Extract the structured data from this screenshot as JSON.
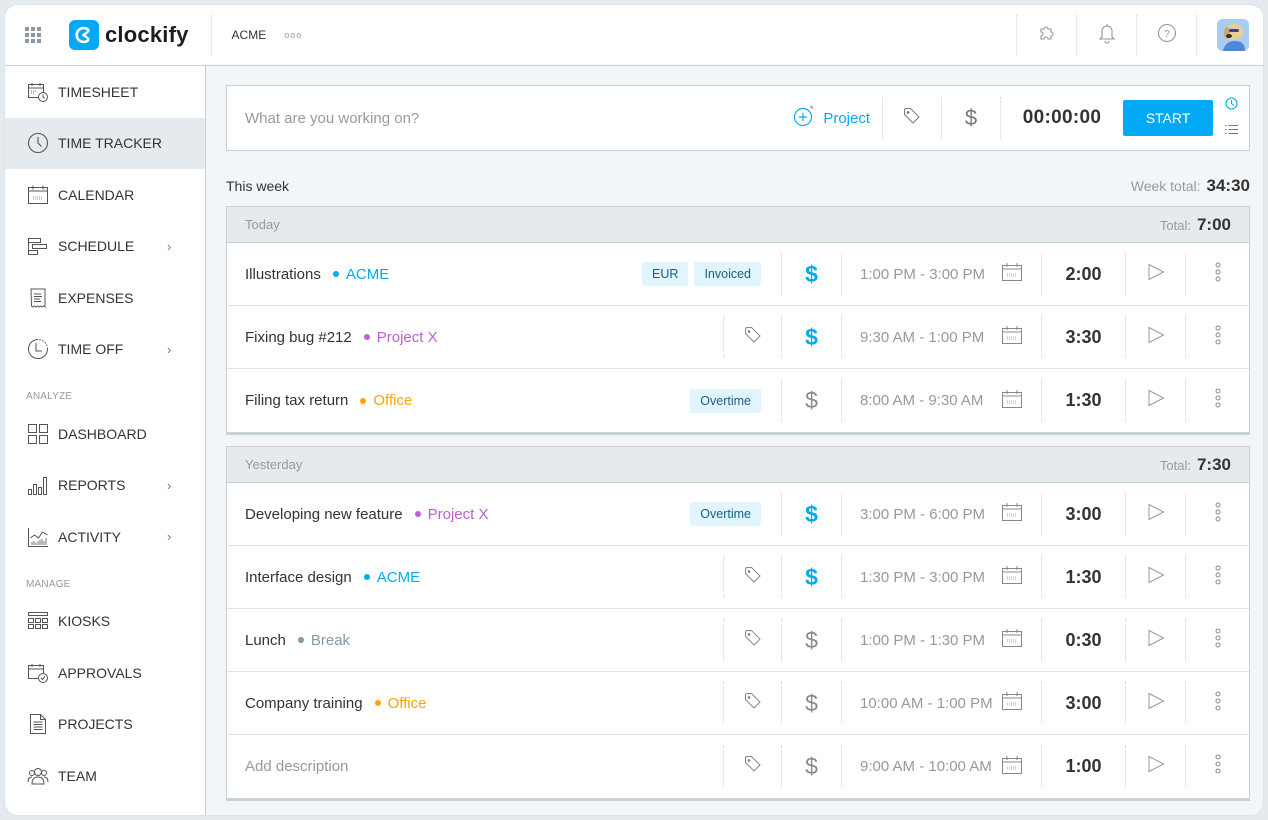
{
  "app": {
    "logo_text": "clockify",
    "workspace": "ACME",
    "workspace_more": "ooo"
  },
  "colors": {
    "accent": "#03a9f4",
    "acme": "#03a9f4",
    "project_x": "#bf5ed6",
    "office": "#ffa500",
    "break": "#8099ac"
  },
  "header": {
    "icons": [
      "puzzle-icon",
      "bell-icon",
      "help-icon"
    ]
  },
  "sidebar": {
    "items": [
      {
        "label": "TIMESHEET",
        "icon": "timesheet-icon",
        "active": false,
        "chevron": false
      },
      {
        "label": "TIME TRACKER",
        "icon": "clock-icon",
        "active": true,
        "chevron": false
      },
      {
        "label": "CALENDAR",
        "icon": "calendar-icon",
        "active": false,
        "chevron": false
      },
      {
        "label": "SCHEDULE",
        "icon": "schedule-icon",
        "active": false,
        "chevron": true
      },
      {
        "label": "EXPENSES",
        "icon": "receipt-icon",
        "active": false,
        "chevron": false
      },
      {
        "label": "TIME OFF",
        "icon": "time-off-icon",
        "active": false,
        "chevron": true
      }
    ],
    "analyze_label": "ANALYZE",
    "analyze_items": [
      {
        "label": "DASHBOARD",
        "icon": "dashboard-icon",
        "chevron": false
      },
      {
        "label": "REPORTS",
        "icon": "reports-icon",
        "chevron": true
      },
      {
        "label": "ACTIVITY",
        "icon": "activity-icon",
        "chevron": true
      }
    ],
    "manage_label": "MANAGE",
    "manage_items": [
      {
        "label": "KIOSKS",
        "icon": "kiosk-icon",
        "chevron": false
      },
      {
        "label": "APPROVALS",
        "icon": "approvals-icon",
        "chevron": false
      },
      {
        "label": "PROJECTS",
        "icon": "projects-icon",
        "chevron": false
      },
      {
        "label": "TEAM",
        "icon": "team-icon",
        "chevron": false
      }
    ]
  },
  "tracker": {
    "placeholder": "What are you working on?",
    "project_label": "Project",
    "timer": "00:00:00",
    "start_label": "START"
  },
  "week": {
    "label": "This week",
    "total_label": "Week total:",
    "total": "34:30"
  },
  "days": [
    {
      "name": "Today",
      "total_label": "Total:",
      "total": "7:00",
      "entries": [
        {
          "description": "Illustrations",
          "project": "ACME",
          "project_color": "#03a9f4",
          "tags": [
            "EUR",
            "Invoiced"
          ],
          "billable": true,
          "time_range": "1:00 PM - 3:00 PM",
          "duration": "2:00"
        },
        {
          "description": "Fixing bug #212",
          "project": "Project X",
          "project_color": "#bf5ed6",
          "tags": [],
          "billable": true,
          "time_range": "9:30 AM - 1:00 PM",
          "duration": "3:30"
        },
        {
          "description": "Filing tax return",
          "project": "Office",
          "project_color": "#ffa500",
          "tags": [
            "Overtime"
          ],
          "billable": false,
          "time_range": "8:00 AM - 9:30 AM",
          "duration": "1:30"
        }
      ]
    },
    {
      "name": "Yesterday",
      "total_label": "Total:",
      "total": "7:30",
      "entries": [
        {
          "description": "Developing new feature",
          "project": "Project X",
          "project_color": "#bf5ed6",
          "tags": [
            "Overtime"
          ],
          "billable": true,
          "time_range": "3:00 PM - 6:00 PM",
          "duration": "3:00"
        },
        {
          "description": "Interface design",
          "project": "ACME",
          "project_color": "#03a9f4",
          "tags": [],
          "billable": true,
          "time_range": "1:30 PM - 3:00 PM",
          "duration": "1:30"
        },
        {
          "description": "Lunch",
          "project": "Break",
          "project_color": "#8099ac",
          "tags": [],
          "billable": false,
          "time_range": "1:00 PM - 1:30 PM",
          "duration": "0:30"
        },
        {
          "description": "Company training",
          "project": "Office",
          "project_color": "#ffa500",
          "tags": [],
          "billable": false,
          "time_range": "10:00 AM - 1:00 PM",
          "duration": "3:00"
        },
        {
          "description": "",
          "description_placeholder": "Add description",
          "project": "",
          "project_color": "",
          "tags": [],
          "billable": false,
          "time_range": "9:00 AM - 10:00 AM",
          "duration": "1:00"
        }
      ]
    }
  ]
}
